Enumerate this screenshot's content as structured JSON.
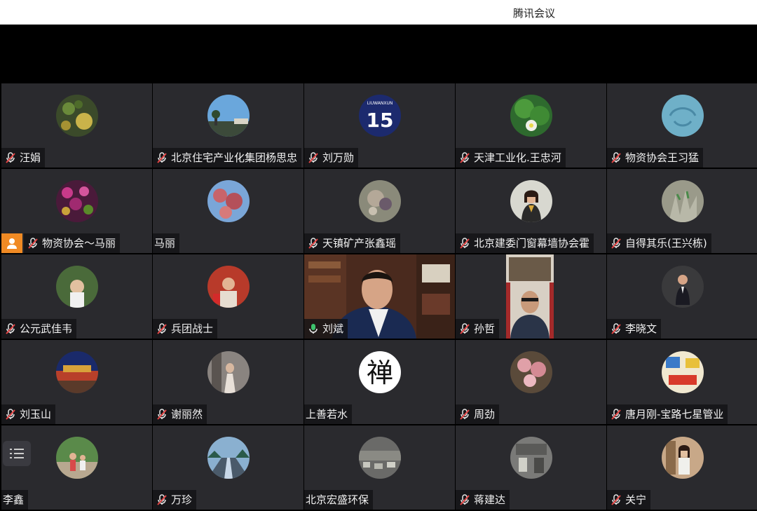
{
  "app": {
    "title": "腾讯会议"
  },
  "participants": [
    {
      "name": "汪娟",
      "mic": "muted"
    },
    {
      "name": "北京住宅产业化集团杨思忠",
      "mic": "muted"
    },
    {
      "name": "刘万勋",
      "mic": "muted"
    },
    {
      "name": "天津工业化.王忠河",
      "mic": "muted"
    },
    {
      "name": "物资协会王习猛",
      "mic": "muted"
    },
    {
      "name": "物资协会～马丽",
      "mic": "muted",
      "host": true
    },
    {
      "name": "马丽",
      "mic": "none"
    },
    {
      "name": "天镇矿产张鑫瑶",
      "mic": "muted"
    },
    {
      "name": "北京建委门窗幕墙协会霍",
      "mic": "muted"
    },
    {
      "name": "自得其乐(王兴栋)",
      "mic": "muted"
    },
    {
      "name": "公元武佳韦",
      "mic": "muted"
    },
    {
      "name": "兵团战士",
      "mic": "muted"
    },
    {
      "name": "刘斌",
      "mic": "active",
      "video": true
    },
    {
      "name": "孙哲",
      "mic": "muted",
      "video": true
    },
    {
      "name": "李晓文",
      "mic": "muted"
    },
    {
      "name": "刘玉山",
      "mic": "muted"
    },
    {
      "name": "谢丽然",
      "mic": "muted"
    },
    {
      "name": "上善若水",
      "mic": "none"
    },
    {
      "name": "周劲",
      "mic": "muted"
    },
    {
      "name": "唐月刚-宝路七星管业",
      "mic": "muted"
    },
    {
      "name": "李鑫",
      "mic": "none",
      "menu": true
    },
    {
      "name": "万珍",
      "mic": "muted"
    },
    {
      "name": "北京宏盛环保",
      "mic": "none"
    },
    {
      "name": "蒋建达",
      "mic": "muted"
    },
    {
      "name": "关宁",
      "mic": "muted"
    }
  ],
  "avatar_texts": {
    "jersey_top": "LIUWANXUN",
    "jersey_number": "15",
    "calligraphy": "禅"
  },
  "colors": {
    "tile_bg": "#2a2a2e",
    "active_border": "#3ec46d",
    "host_badge": "#f08a24",
    "mic_muted": "#e64545",
    "mic_active": "#3ec46d"
  },
  "icons": {
    "mic_muted": "mic-muted-icon",
    "mic_active": "mic-active-icon",
    "host": "person-icon",
    "menu": "list-menu-icon"
  }
}
